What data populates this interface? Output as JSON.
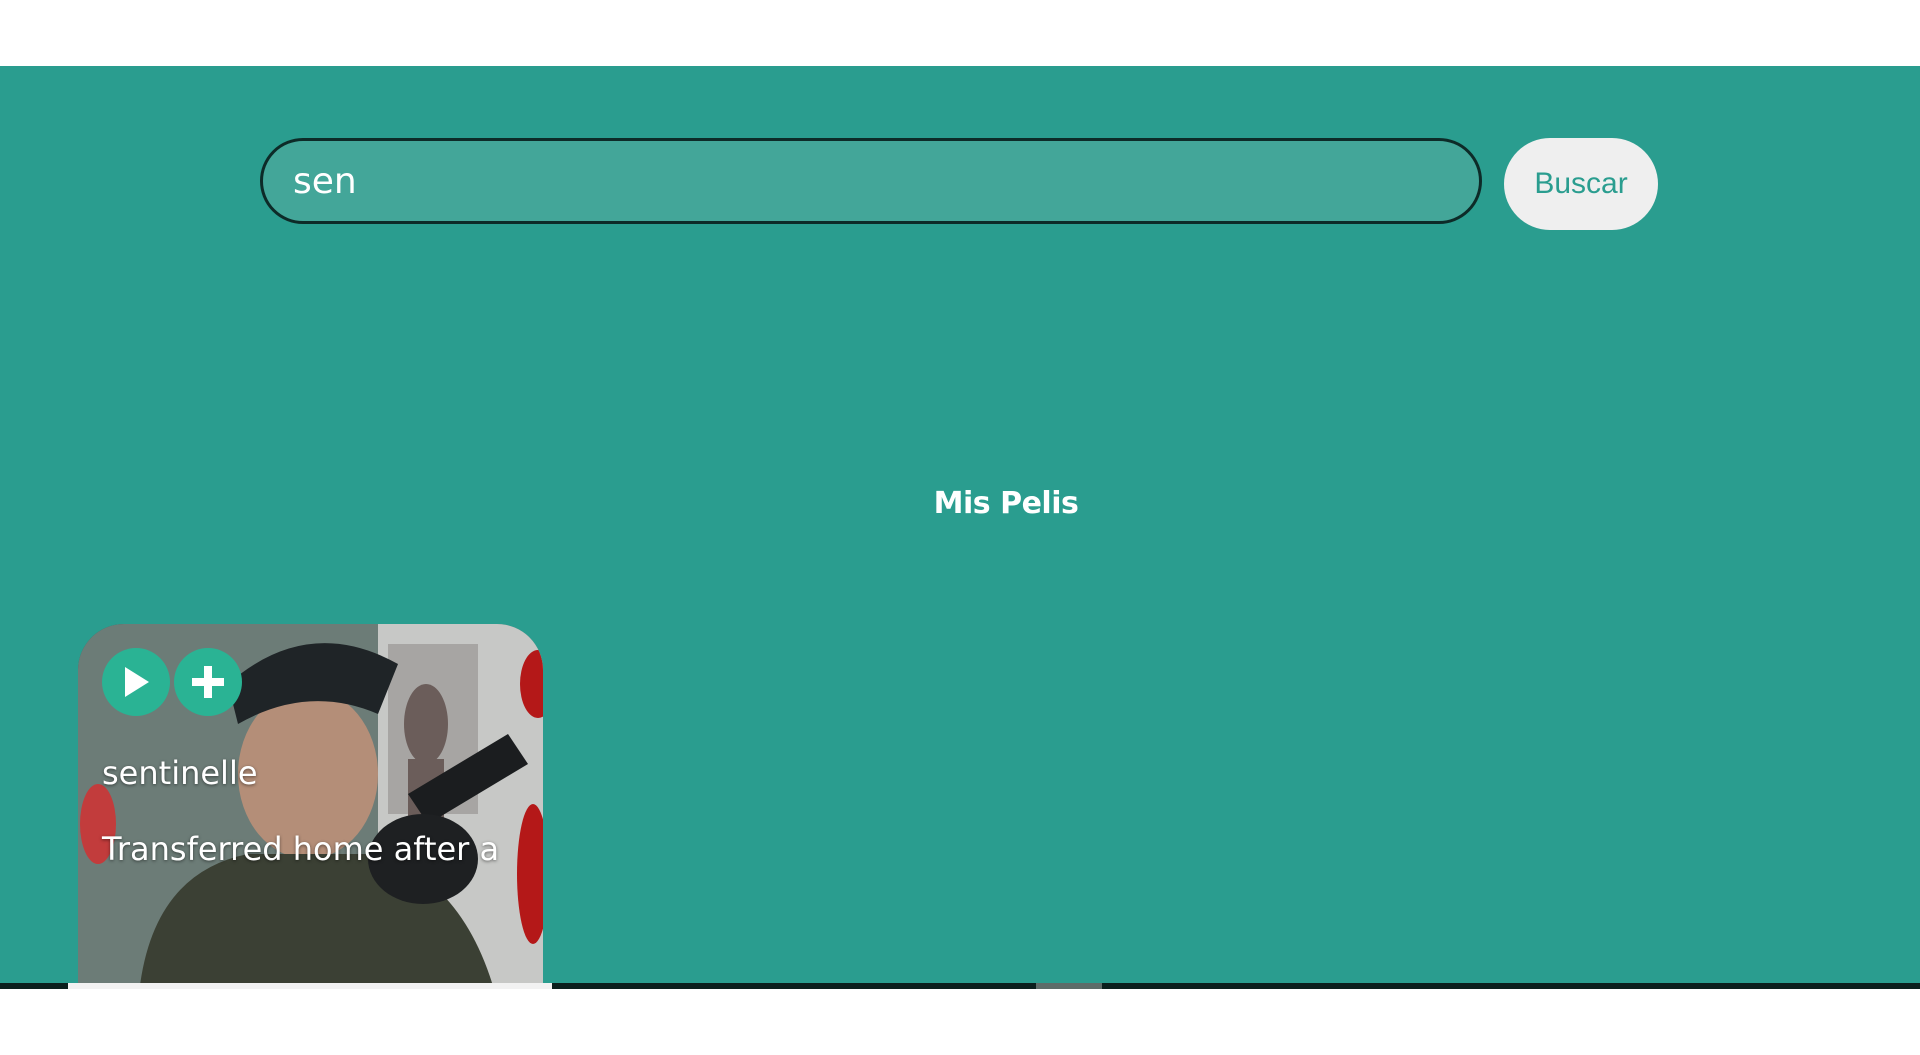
{
  "search": {
    "value": "sen",
    "button_label": "Buscar"
  },
  "section": {
    "title": "Mis Pelis"
  },
  "movie_card": {
    "title": "sentinelle",
    "description": "Transferred home after a",
    "play_icon": "play-icon",
    "add_icon": "plus-icon"
  },
  "colors": {
    "background": "#2a9d8f",
    "search_fill": "#43a699",
    "button_fill": "#efefef",
    "action_button": "#2ab394"
  }
}
